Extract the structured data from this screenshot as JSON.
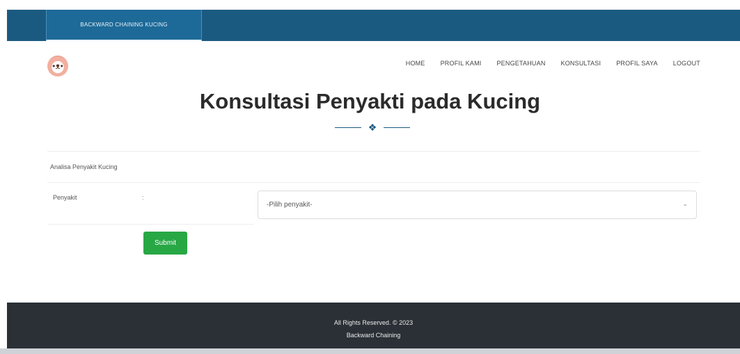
{
  "header": {
    "brand": "BACKWARD CHAINING KUCING"
  },
  "nav": {
    "items": [
      "HOME",
      "PROFIL KAMI",
      "PENGETAHUAN",
      "KONSULTASI",
      "PROFIL SAYA",
      "LOGOUT"
    ]
  },
  "main": {
    "title": "Konsultasi Penyakti pada Kucing",
    "section_label": "Analisa Penyakit Kucing",
    "field_label": "Penyakit",
    "colon": ":",
    "select_value": "-Pilih penyakit-",
    "submit_label": "Submit"
  },
  "footer": {
    "line1": "All Rights Reserved. © 2023",
    "line2": "Backward Chaining"
  },
  "icons": {
    "logo": "cat-face-icon",
    "divider": "paw-icon",
    "select": "chevron-down-icon"
  },
  "colors": {
    "header_bg": "#1b5a80",
    "submit_bg": "#28a745",
    "footer_bg": "#2a3036"
  }
}
